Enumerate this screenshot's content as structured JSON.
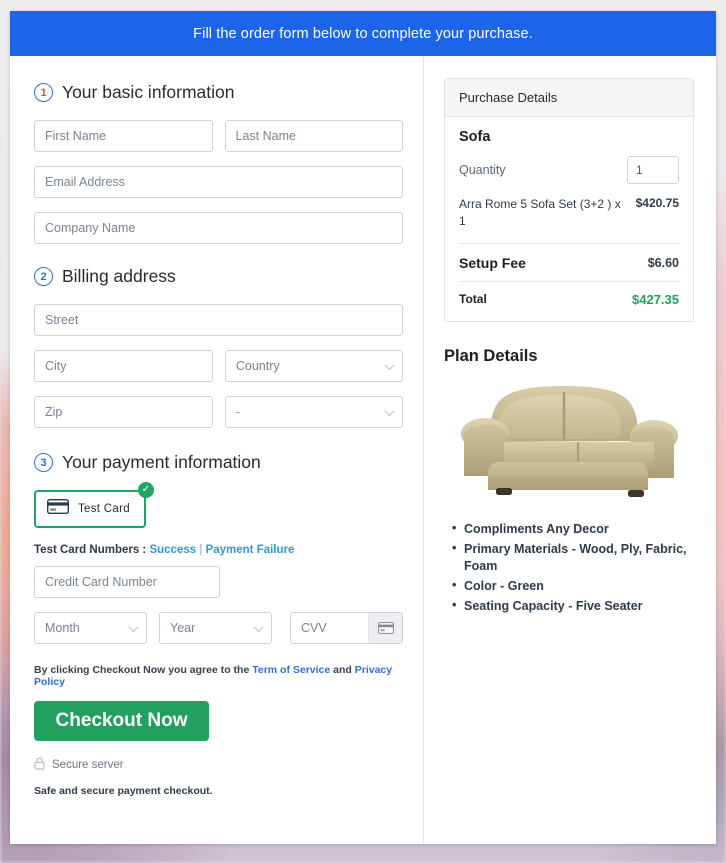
{
  "banner": {
    "text": "Fill the order form below to complete your purchase."
  },
  "steps": {
    "basic": {
      "num": "1",
      "title": "Your basic information"
    },
    "billing": {
      "num": "2",
      "title": "Billing address"
    },
    "payment": {
      "num": "3",
      "title": "Your payment information"
    }
  },
  "basic_fields": {
    "first_name": {
      "placeholder": "First Name",
      "value": ""
    },
    "last_name": {
      "placeholder": "Last Name",
      "value": ""
    },
    "email": {
      "placeholder": "Email Address",
      "value": ""
    },
    "company": {
      "placeholder": "Company Name",
      "value": ""
    }
  },
  "billing_fields": {
    "street": {
      "placeholder": "Street",
      "value": ""
    },
    "city": {
      "placeholder": "City",
      "value": ""
    },
    "country": {
      "placeholder": "Country",
      "value": ""
    },
    "zip": {
      "placeholder": "Zip",
      "value": ""
    },
    "state": {
      "placeholder": "-",
      "value": ""
    }
  },
  "payment": {
    "tile_label": "Test  Card",
    "tile_icon": "credit-card-icon",
    "tile_check_icon": "check-circle-icon",
    "tile_border_color": "#1fa463",
    "testcards_label": "Test Card Numbers :",
    "success_link": "Success",
    "separator": "|",
    "failure_link": "Payment Failure",
    "card_number": {
      "placeholder": "Credit Card Number",
      "value": ""
    },
    "month": {
      "placeholder": "Month",
      "value": ""
    },
    "year": {
      "placeholder": "Year",
      "value": ""
    },
    "cvv": {
      "placeholder": "CVV",
      "value": ""
    },
    "cvv_icon": "credit-card-icon"
  },
  "terms": {
    "prefix": "By clicking Checkout Now you agree to the",
    "tos_link": "Term of Service",
    "conjunction": "and",
    "privacy_link": "Privacy Policy"
  },
  "checkout": {
    "button_label": "Checkout Now",
    "button_color": "#21a05e",
    "secure_icon": "lock-icon",
    "secure_label": "Secure server",
    "safe_note": "Safe and secure payment checkout."
  },
  "purchase": {
    "heading": "Purchase Details",
    "product_name": "Sofa",
    "quantity_label": "Quantity",
    "quantity_value": "1",
    "line_item": {
      "desc": "Arra Rome 5 Sofa Set (3+2 ) x 1",
      "amount": "$420.75"
    },
    "setup_fee": {
      "desc": "Setup Fee",
      "amount": "$6.60"
    },
    "total": {
      "desc": "Total",
      "amount": "$427.35",
      "color": "#1fa463"
    }
  },
  "plan": {
    "title": "Plan Details",
    "image_alt": "sofa-product-image",
    "features": [
      "Compliments Any Decor",
      "Primary Materials - Wood, Ply, Fabric, Foam",
      "Color - Green",
      "Seating Capacity - Five Seater"
    ]
  }
}
